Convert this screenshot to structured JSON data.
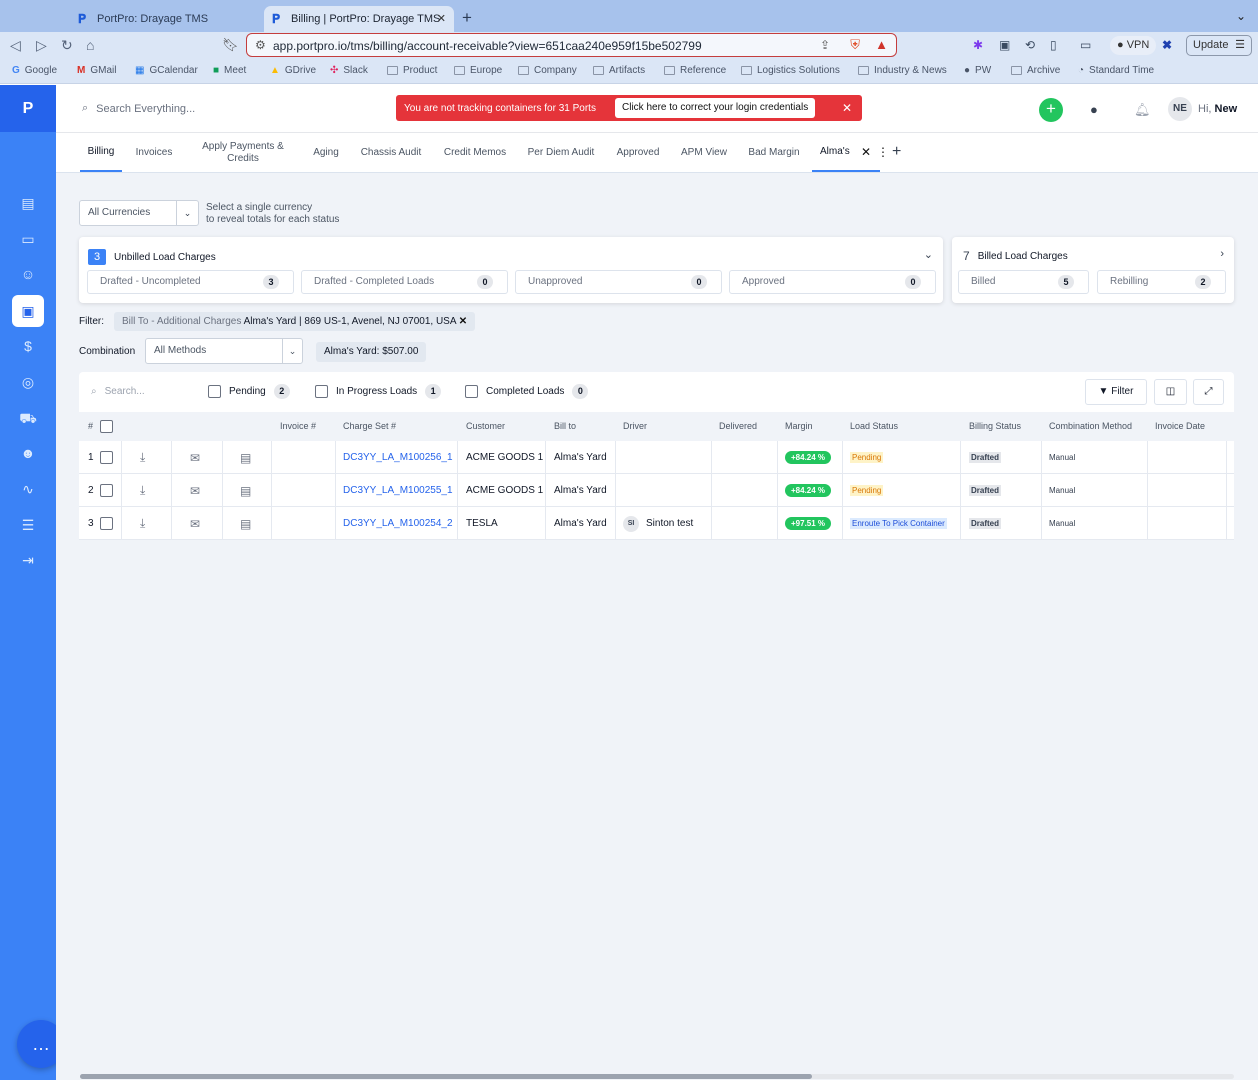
{
  "browser": {
    "tabs": [
      {
        "title": "PortPro: Drayage TMS",
        "active": false
      },
      {
        "title": "Billing | PortPro: Drayage TMS",
        "active": true
      }
    ],
    "url": "app.portpro.io/tms/billing/account-receivable?view=651caa240e959f15be502799",
    "vpn_label": "VPN",
    "update_label": "Update",
    "bookmarks": [
      "Google",
      "GMail",
      "GCalendar",
      "Meet",
      "GDrive",
      "Slack",
      "Product",
      "Europe",
      "Company",
      "Artifacts",
      "Reference",
      "Logistics Solutions",
      "Industry & News",
      "PW",
      "Archive",
      "Standard Time"
    ]
  },
  "app": {
    "logo": "P",
    "search_placeholder": "Search Everything...",
    "alert": {
      "message": "You are not tracking containers for 31 Ports",
      "action": "Click here to correct your login credentials"
    },
    "user": {
      "initials": "NE",
      "greeting": "Hi,",
      "name": "New"
    },
    "tabs": [
      "Billing",
      "Invoices",
      "Apply Payments & Credits",
      "Aging",
      "Chassis Audit",
      "Credit Memos",
      "Per Diem Audit",
      "Approved",
      "APM View",
      "Bad Margin",
      "Alma's"
    ]
  },
  "currency": {
    "selected": "All Currencies",
    "hint_line1": "Select a single currency",
    "hint_line2": "to reveal totals for each status"
  },
  "unbilled": {
    "count": "3",
    "title": "Unbilled Load Charges",
    "stats": [
      {
        "label": "Drafted - Uncompleted",
        "count": "3"
      },
      {
        "label": "Drafted - Completed Loads",
        "count": "0"
      },
      {
        "label": "Unapproved",
        "count": "0"
      },
      {
        "label": "Approved",
        "count": "0"
      }
    ]
  },
  "billed": {
    "count": "7",
    "title": "Billed Load Charges",
    "stats": [
      {
        "label": "Billed",
        "count": "5"
      },
      {
        "label": "Rebilling",
        "count": "2"
      }
    ]
  },
  "filter": {
    "label": "Filter:",
    "chip_key": "Bill To - Additional Charges",
    "chip_value": "Alma's Yard | 869 US-1, Avenel, NJ 07001, USA"
  },
  "combination": {
    "label": "Combination",
    "selected": "All Methods",
    "total": "Alma's Yard: $507.00"
  },
  "grid_toolbar": {
    "search_placeholder": "Search...",
    "pending_label": "Pending",
    "pending_count": "2",
    "inprogress_label": "In Progress Loads",
    "inprogress_count": "1",
    "completed_label": "Completed Loads",
    "completed_count": "0",
    "filter_label": "Filter"
  },
  "columns": [
    "#",
    "Invoice #",
    "Charge Set #",
    "Customer",
    "Bill to",
    "Driver",
    "Delivered",
    "Margin",
    "Load Status",
    "Billing Status",
    "Combination Method",
    "Invoice Date"
  ],
  "rows": [
    {
      "num": "1",
      "invoice": "",
      "charge_set": "DC3YY_LA_M100256_1",
      "customer": "ACME GOODS 1",
      "bill_to": "Alma's Yard",
      "driver_initials": "",
      "driver": "",
      "delivered": "",
      "margin": "+84.24 %",
      "load_status": "Pending",
      "billing_status": "Drafted",
      "method": "Manual",
      "invoice_date": ""
    },
    {
      "num": "2",
      "invoice": "",
      "charge_set": "DC3YY_LA_M100255_1",
      "customer": "ACME GOODS 1",
      "bill_to": "Alma's Yard",
      "driver_initials": "",
      "driver": "",
      "delivered": "",
      "margin": "+84.24 %",
      "load_status": "Pending",
      "billing_status": "Drafted",
      "method": "Manual",
      "invoice_date": ""
    },
    {
      "num": "3",
      "invoice": "",
      "charge_set": "DC3YY_LA_M100254_2",
      "customer": "TESLA",
      "bill_to": "Alma's Yard",
      "driver_initials": "SI",
      "driver": "Sinton test",
      "delivered": "",
      "margin": "+97.51 %",
      "load_status": "Enroute To Pick Container",
      "billing_status": "Drafted",
      "method": "Manual",
      "invoice_date": ""
    }
  ],
  "colors": {
    "brand": "#3b82f6",
    "alert": "#e5343a",
    "success": "#22c55e"
  }
}
